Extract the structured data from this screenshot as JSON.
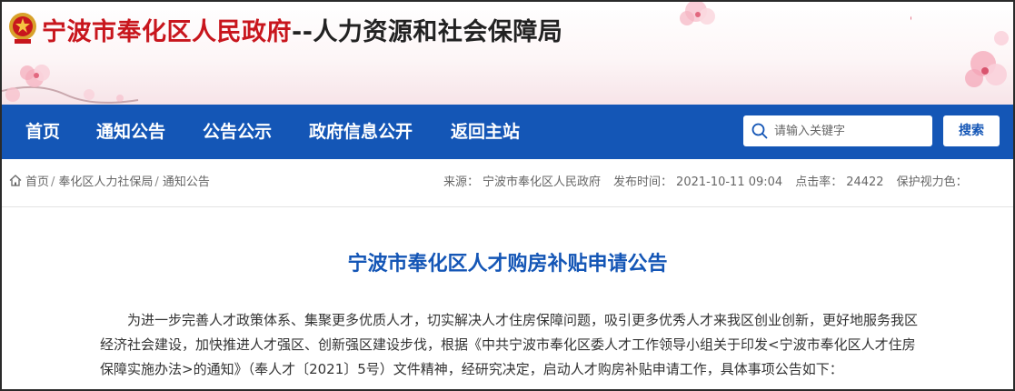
{
  "header": {
    "title_prefix": "宁波市奉化区人民政府",
    "title_suffix": "--人力资源和社会保障局",
    "emblem_icon": "national-emblem-icon"
  },
  "nav": {
    "items": [
      {
        "label": "首页"
      },
      {
        "label": "通知公告"
      },
      {
        "label": "公告公示"
      },
      {
        "label": "政府信息公开"
      },
      {
        "label": "返回主站"
      }
    ],
    "search_placeholder": "请输入关键字",
    "search_button": "搜索",
    "bar_color": "#1456b6"
  },
  "breadcrumb": {
    "items": [
      "首页",
      "奉化区人力社保局",
      "通知公告"
    ],
    "separator": "/"
  },
  "meta": {
    "source_label": "来源：",
    "source": "宁波市奉化区人民政府",
    "time_label": "发布时间：",
    "time": "2021-10-11 09:04",
    "clicks_label": "点击率：",
    "clicks": "24422",
    "eye_protect": "保护视力色："
  },
  "article": {
    "title": "宁波市奉化区人才购房补贴申请公告",
    "paragraph": "为进一步完善人才政策体系、集聚更多优质人才，切实解决人才住房保障问题，吸引更多优秀人才来我区创业创新，更好地服务我区经济社会建设，加快推进人才强区、创新强区建设步伐，根据《中共宁波市奉化区委人才工作领导小组关于印发<宁波市奉化区人才住房保障实施办法>的通知》（奉人才〔2021〕5号）文件精神，经研究决定，启动人才购房补贴申请工作，具体事项公告如下："
  }
}
